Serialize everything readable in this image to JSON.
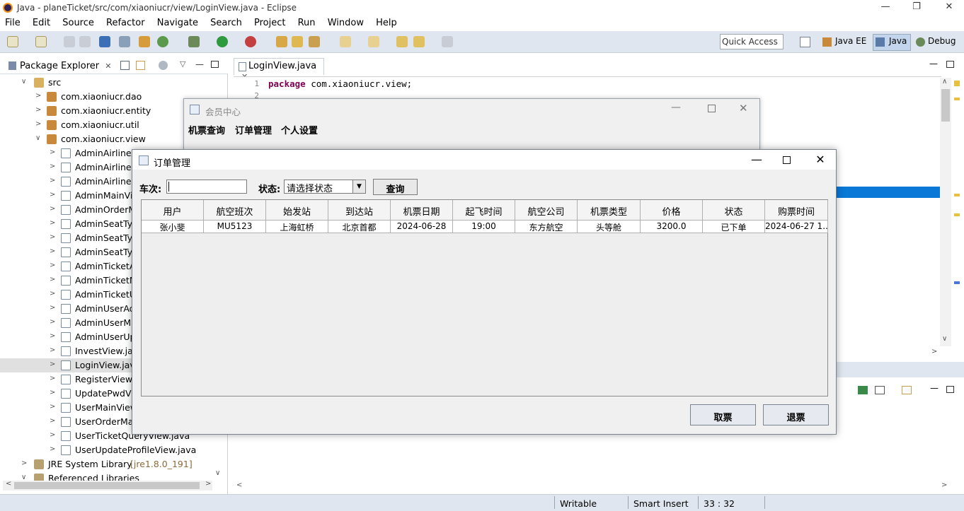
{
  "window": {
    "title": "Java - planeTicket/src/com/xiaoniucr/view/LoginView.java - Eclipse",
    "min": "—",
    "max": "❐",
    "close": "✕"
  },
  "menu": [
    "File",
    "Edit",
    "Source",
    "Refactor",
    "Navigate",
    "Search",
    "Project",
    "Run",
    "Window",
    "Help"
  ],
  "toolbar": {
    "quick_access": "Quick Access",
    "perspectives": [
      "Java EE",
      "Java",
      "Debug"
    ]
  },
  "package_explorer": {
    "tab": "Package Explorer",
    "items": [
      {
        "label": "src",
        "level": 1,
        "arrow": "v",
        "icon": "src"
      },
      {
        "label": "com.xiaoniucr.dao",
        "level": 2,
        "arrow": ">",
        "icon": "pkg"
      },
      {
        "label": "com.xiaoniucr.entity",
        "level": 2,
        "arrow": ">",
        "icon": "pkg"
      },
      {
        "label": "com.xiaoniucr.util",
        "level": 2,
        "arrow": ">",
        "icon": "pkg"
      },
      {
        "label": "com.xiaoniucr.view",
        "level": 2,
        "arrow": "v",
        "icon": "pkg"
      },
      {
        "label": "AdminAirlineA",
        "level": 3,
        "arrow": ">",
        "icon": "java"
      },
      {
        "label": "AdminAirlineM",
        "level": 3,
        "arrow": ">",
        "icon": "java"
      },
      {
        "label": "AdminAirlineU",
        "level": 3,
        "arrow": ">",
        "icon": "java"
      },
      {
        "label": "AdminMainVie",
        "level": 3,
        "arrow": ">",
        "icon": "java"
      },
      {
        "label": "AdminOrderM",
        "level": 3,
        "arrow": ">",
        "icon": "java"
      },
      {
        "label": "AdminSeatTyp",
        "level": 3,
        "arrow": ">",
        "icon": "java"
      },
      {
        "label": "AdminSeatTyp",
        "level": 3,
        "arrow": ">",
        "icon": "java"
      },
      {
        "label": "AdminSeatTyp",
        "level": 3,
        "arrow": ">",
        "icon": "java"
      },
      {
        "label": "AdminTicketA",
        "level": 3,
        "arrow": ">",
        "icon": "java"
      },
      {
        "label": "AdminTicketM",
        "level": 3,
        "arrow": ">",
        "icon": "java"
      },
      {
        "label": "AdminTicketU",
        "level": 3,
        "arrow": ">",
        "icon": "java"
      },
      {
        "label": "AdminUserAd",
        "level": 3,
        "arrow": ">",
        "icon": "java"
      },
      {
        "label": "AdminUserMa",
        "level": 3,
        "arrow": ">",
        "icon": "java"
      },
      {
        "label": "AdminUserUp",
        "level": 3,
        "arrow": ">",
        "icon": "java"
      },
      {
        "label": "InvestView.java",
        "level": 3,
        "arrow": ">",
        "icon": "java"
      },
      {
        "label": "LoginView.java",
        "level": 3,
        "arrow": ">",
        "icon": "java",
        "selected": true
      },
      {
        "label": "RegisterView.j",
        "level": 3,
        "arrow": ">",
        "icon": "java"
      },
      {
        "label": "UpdatePwdVie",
        "level": 3,
        "arrow": ">",
        "icon": "java"
      },
      {
        "label": "UserMainView",
        "level": 3,
        "arrow": ">",
        "icon": "java"
      },
      {
        "label": "UserOrderMa",
        "level": 3,
        "arrow": ">",
        "icon": "java"
      },
      {
        "label": "UserTicketQueryView.java",
        "level": 3,
        "arrow": ">",
        "icon": "java"
      },
      {
        "label": "UserUpdateProfileView.java",
        "level": 3,
        "arrow": ">",
        "icon": "java"
      },
      {
        "label": "JRE System Library",
        "suffix": "[jre1.8.0_191]",
        "level": 1,
        "arrow": ">",
        "icon": "lib"
      },
      {
        "label": "Referenced Libraries",
        "level": 1,
        "arrow": "v",
        "icon": "lib"
      }
    ]
  },
  "editor": {
    "tab": "LoginView.java",
    "lines": [
      {
        "num": "1",
        "kw": "package",
        "rest": " com.xiaoniucr.view;"
      },
      {
        "num": "2",
        "kw": "",
        "rest": ""
      }
    ]
  },
  "member_window": {
    "title": "会员中心",
    "menu": [
      "机票查询",
      "订单管理",
      "个人设置"
    ]
  },
  "order_window": {
    "title": "订单管理",
    "car_label": "车次:",
    "state_label": "状态:",
    "state_value": "请选择状态",
    "query_button": "查询",
    "columns": [
      "用户",
      "航空班次",
      "始发站",
      "到达站",
      "机票日期",
      "起飞时间",
      "航空公司",
      "机票类型",
      "价格",
      "状态",
      "购票时间"
    ],
    "rows": [
      [
        "张小斐",
        "MU5123",
        "上海虹桥",
        "北京首都",
        "2024-06-28",
        "19:00",
        "东方航空",
        "头等舱",
        "3200.0",
        "已下单",
        "2024-06-27 1..."
      ]
    ],
    "take_button": "取票",
    "refund_button": "退票"
  },
  "status": {
    "writable": "Writable",
    "insert": "Smart Insert",
    "position": "33 : 32"
  }
}
